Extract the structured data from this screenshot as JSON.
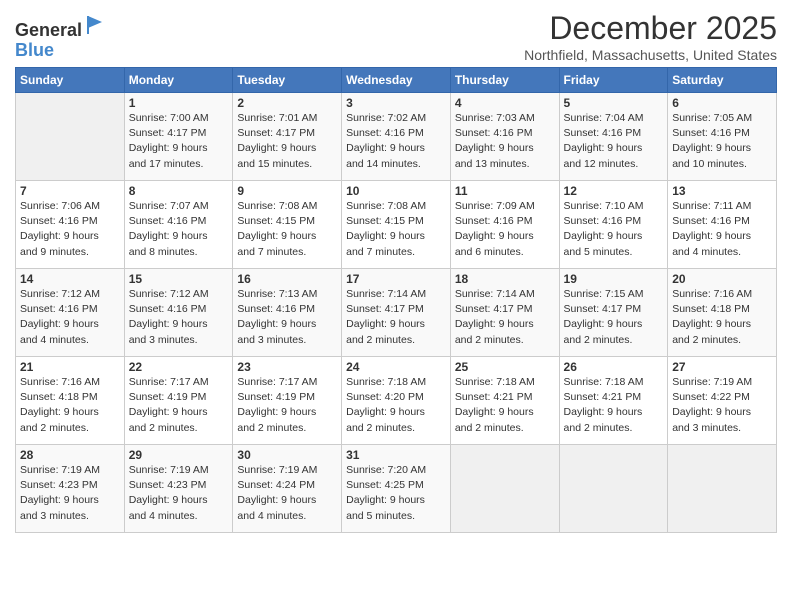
{
  "logo": {
    "general": "General",
    "blue": "Blue"
  },
  "title": "December 2025",
  "location": "Northfield, Massachusetts, United States",
  "days_of_week": [
    "Sunday",
    "Monday",
    "Tuesday",
    "Wednesday",
    "Thursday",
    "Friday",
    "Saturday"
  ],
  "weeks": [
    [
      {
        "day": "",
        "info": ""
      },
      {
        "day": "1",
        "info": "Sunrise: 7:00 AM\nSunset: 4:17 PM\nDaylight: 9 hours\nand 17 minutes."
      },
      {
        "day": "2",
        "info": "Sunrise: 7:01 AM\nSunset: 4:17 PM\nDaylight: 9 hours\nand 15 minutes."
      },
      {
        "day": "3",
        "info": "Sunrise: 7:02 AM\nSunset: 4:16 PM\nDaylight: 9 hours\nand 14 minutes."
      },
      {
        "day": "4",
        "info": "Sunrise: 7:03 AM\nSunset: 4:16 PM\nDaylight: 9 hours\nand 13 minutes."
      },
      {
        "day": "5",
        "info": "Sunrise: 7:04 AM\nSunset: 4:16 PM\nDaylight: 9 hours\nand 12 minutes."
      },
      {
        "day": "6",
        "info": "Sunrise: 7:05 AM\nSunset: 4:16 PM\nDaylight: 9 hours\nand 10 minutes."
      }
    ],
    [
      {
        "day": "7",
        "info": "Sunrise: 7:06 AM\nSunset: 4:16 PM\nDaylight: 9 hours\nand 9 minutes."
      },
      {
        "day": "8",
        "info": "Sunrise: 7:07 AM\nSunset: 4:16 PM\nDaylight: 9 hours\nand 8 minutes."
      },
      {
        "day": "9",
        "info": "Sunrise: 7:08 AM\nSunset: 4:15 PM\nDaylight: 9 hours\nand 7 minutes."
      },
      {
        "day": "10",
        "info": "Sunrise: 7:08 AM\nSunset: 4:15 PM\nDaylight: 9 hours\nand 7 minutes."
      },
      {
        "day": "11",
        "info": "Sunrise: 7:09 AM\nSunset: 4:16 PM\nDaylight: 9 hours\nand 6 minutes."
      },
      {
        "day": "12",
        "info": "Sunrise: 7:10 AM\nSunset: 4:16 PM\nDaylight: 9 hours\nand 5 minutes."
      },
      {
        "day": "13",
        "info": "Sunrise: 7:11 AM\nSunset: 4:16 PM\nDaylight: 9 hours\nand 4 minutes."
      }
    ],
    [
      {
        "day": "14",
        "info": "Sunrise: 7:12 AM\nSunset: 4:16 PM\nDaylight: 9 hours\nand 4 minutes."
      },
      {
        "day": "15",
        "info": "Sunrise: 7:12 AM\nSunset: 4:16 PM\nDaylight: 9 hours\nand 3 minutes."
      },
      {
        "day": "16",
        "info": "Sunrise: 7:13 AM\nSunset: 4:16 PM\nDaylight: 9 hours\nand 3 minutes."
      },
      {
        "day": "17",
        "info": "Sunrise: 7:14 AM\nSunset: 4:17 PM\nDaylight: 9 hours\nand 2 minutes."
      },
      {
        "day": "18",
        "info": "Sunrise: 7:14 AM\nSunset: 4:17 PM\nDaylight: 9 hours\nand 2 minutes."
      },
      {
        "day": "19",
        "info": "Sunrise: 7:15 AM\nSunset: 4:17 PM\nDaylight: 9 hours\nand 2 minutes."
      },
      {
        "day": "20",
        "info": "Sunrise: 7:16 AM\nSunset: 4:18 PM\nDaylight: 9 hours\nand 2 minutes."
      }
    ],
    [
      {
        "day": "21",
        "info": "Sunrise: 7:16 AM\nSunset: 4:18 PM\nDaylight: 9 hours\nand 2 minutes."
      },
      {
        "day": "22",
        "info": "Sunrise: 7:17 AM\nSunset: 4:19 PM\nDaylight: 9 hours\nand 2 minutes."
      },
      {
        "day": "23",
        "info": "Sunrise: 7:17 AM\nSunset: 4:19 PM\nDaylight: 9 hours\nand 2 minutes."
      },
      {
        "day": "24",
        "info": "Sunrise: 7:18 AM\nSunset: 4:20 PM\nDaylight: 9 hours\nand 2 minutes."
      },
      {
        "day": "25",
        "info": "Sunrise: 7:18 AM\nSunset: 4:21 PM\nDaylight: 9 hours\nand 2 minutes."
      },
      {
        "day": "26",
        "info": "Sunrise: 7:18 AM\nSunset: 4:21 PM\nDaylight: 9 hours\nand 2 minutes."
      },
      {
        "day": "27",
        "info": "Sunrise: 7:19 AM\nSunset: 4:22 PM\nDaylight: 9 hours\nand 3 minutes."
      }
    ],
    [
      {
        "day": "28",
        "info": "Sunrise: 7:19 AM\nSunset: 4:23 PM\nDaylight: 9 hours\nand 3 minutes."
      },
      {
        "day": "29",
        "info": "Sunrise: 7:19 AM\nSunset: 4:23 PM\nDaylight: 9 hours\nand 4 minutes."
      },
      {
        "day": "30",
        "info": "Sunrise: 7:19 AM\nSunset: 4:24 PM\nDaylight: 9 hours\nand 4 minutes."
      },
      {
        "day": "31",
        "info": "Sunrise: 7:20 AM\nSunset: 4:25 PM\nDaylight: 9 hours\nand 5 minutes."
      },
      {
        "day": "",
        "info": ""
      },
      {
        "day": "",
        "info": ""
      },
      {
        "day": "",
        "info": ""
      }
    ]
  ]
}
